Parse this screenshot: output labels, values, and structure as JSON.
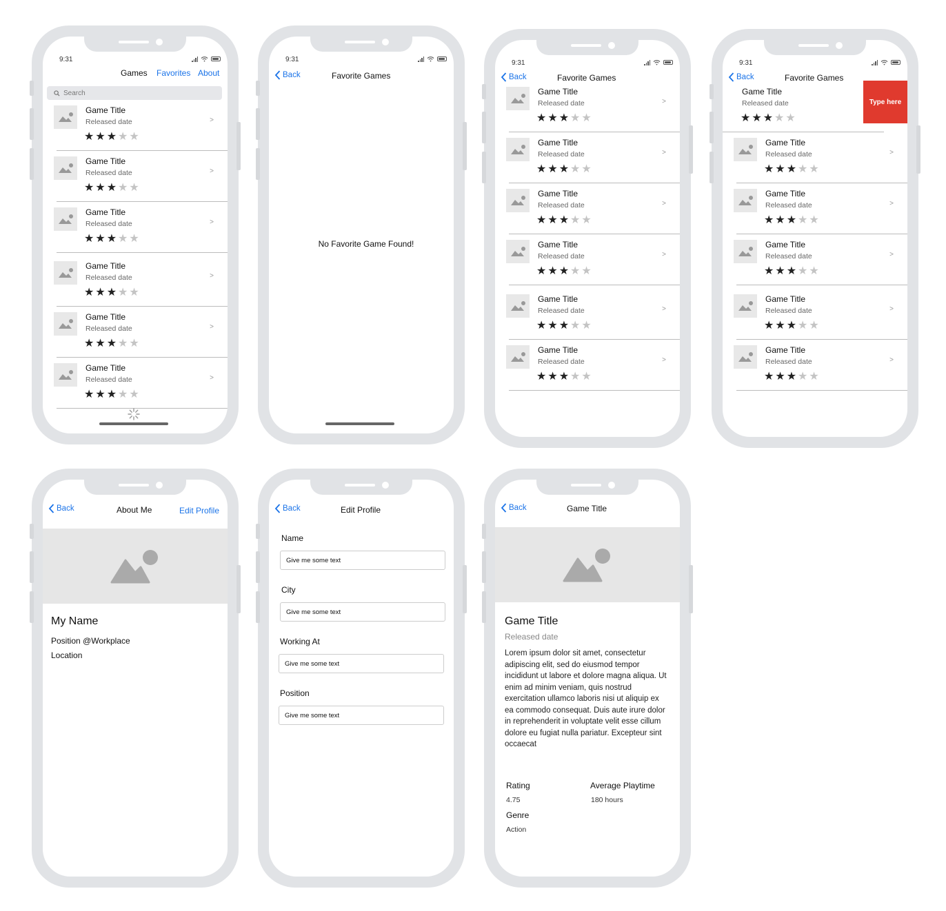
{
  "status": {
    "time": "9:31"
  },
  "icons": {
    "back": "chevron-left-icon",
    "search": "search-icon",
    "placeholder": "image-placeholder-icon",
    "spinner": "loading-spinner-icon"
  },
  "colors": {
    "link": "#1a73e8",
    "delete_action": "#e03a2e",
    "frame": "#e1e3e6"
  },
  "games_list": {
    "tabs": {
      "games": "Games",
      "favorites": "Favorites",
      "about": "About"
    },
    "search_placeholder": "Search",
    "items": [
      {
        "title": "Game Title",
        "date": "Released date",
        "rating": 3,
        "max": 5
      },
      {
        "title": "Game Title",
        "date": "Released date",
        "rating": 3,
        "max": 5
      },
      {
        "title": "Game Title",
        "date": "Released date",
        "rating": 3,
        "max": 5
      },
      {
        "title": "Game Title",
        "date": "Released date",
        "rating": 3,
        "max": 5
      },
      {
        "title": "Game Title",
        "date": "Released date",
        "rating": 3,
        "max": 5
      },
      {
        "title": "Game Title",
        "date": "Released date",
        "rating": 3,
        "max": 5
      }
    ]
  },
  "favorites_empty": {
    "back": "Back",
    "title": "Favorite Games",
    "message": "No Favorite Game Found!"
  },
  "favorites_list": {
    "back": "Back",
    "title": "Favorite Games",
    "items": [
      {
        "title": "Game Title",
        "date": "Released date",
        "rating": 3,
        "max": 5
      },
      {
        "title": "Game Title",
        "date": "Released date",
        "rating": 3,
        "max": 5
      },
      {
        "title": "Game Title",
        "date": "Released date",
        "rating": 3,
        "max": 5
      },
      {
        "title": "Game Title",
        "date": "Released date",
        "rating": 3,
        "max": 5
      },
      {
        "title": "Game Title",
        "date": "Released date",
        "rating": 3,
        "max": 5
      },
      {
        "title": "Game Title",
        "date": "Released date",
        "rating": 3,
        "max": 5
      }
    ]
  },
  "favorites_swipe": {
    "back": "Back",
    "title": "Favorite Games",
    "swipe_action": "Type here",
    "items": [
      {
        "title": "Game Title",
        "date": "Released date",
        "rating": 3,
        "max": 5
      },
      {
        "title": "Game Title",
        "date": "Released date",
        "rating": 3,
        "max": 5
      },
      {
        "title": "Game Title",
        "date": "Released date",
        "rating": 3,
        "max": 5
      },
      {
        "title": "Game Title",
        "date": "Released date",
        "rating": 3,
        "max": 5
      },
      {
        "title": "Game Title",
        "date": "Released date",
        "rating": 3,
        "max": 5
      },
      {
        "title": "Game Title",
        "date": "Released date",
        "rating": 3,
        "max": 5
      }
    ]
  },
  "about": {
    "back": "Back",
    "title": "About Me",
    "edit": "Edit Profile",
    "name": "My Name",
    "position": "Position @Workplace",
    "location": "Location"
  },
  "edit_profile": {
    "back": "Back",
    "title": "Edit Profile",
    "fields": [
      {
        "label": "Name",
        "value": "Give me some text"
      },
      {
        "label": "City",
        "value": "Give me some text"
      },
      {
        "label": "Working At",
        "value": "Give me some text"
      },
      {
        "label": "Position",
        "value": "Give me some text"
      }
    ]
  },
  "detail": {
    "back": "Back",
    "title": "Game Title",
    "heading": "Game Title",
    "date": "Released date",
    "description": "Lorem ipsum dolor sit amet, consectetur adipiscing elit, sed do eiusmod tempor incididunt ut labore et dolore magna aliqua. Ut enim ad minim veniam, quis nostrud exercitation ullamco laboris nisi ut aliquip ex ea commodo consequat. Duis aute irure dolor in reprehenderit in voluptate velit esse cillum dolore eu fugiat nulla pariatur. Excepteur sint occaecat",
    "rating_label": "Rating",
    "rating": "4.75",
    "playtime_label": "Average Playtime",
    "playtime": "180 hours",
    "genre_label": "Genre",
    "genre": "Action"
  }
}
